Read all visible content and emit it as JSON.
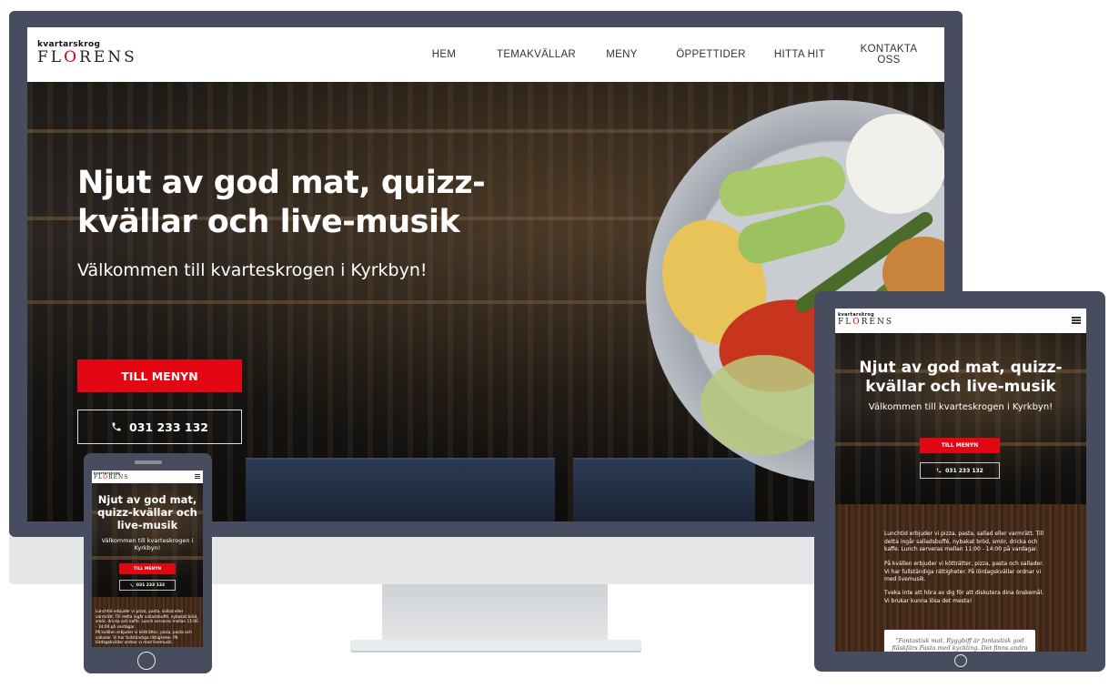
{
  "brand": {
    "logo_top": "kvartarskrog",
    "logo_bottom_pre": "FL",
    "logo_bottom_red": "O",
    "logo_bottom_post": "RENS",
    "accent_color": "#e30613"
  },
  "nav": {
    "items": [
      "HEM",
      "TEMAKVÄLLAR",
      "MENY",
      "ÖPPETTIDER",
      "HITTA HIT",
      "KONTAKTA OSS"
    ]
  },
  "hero": {
    "title": "Njut av god mat, quizz-kvällar och live-musik",
    "subtitle_desktop": "Välkommen till kvarteskrogen i Kyrkbyn!",
    "subtitle_mobile": "Välkommen till kvarteskrogen i Kyrkbyn!",
    "menu_button": "TILL MENYN",
    "phone_icon": "phone-icon",
    "phone_button": "031 233 132"
  },
  "content": {
    "tablet_paragraph_1": "Lunchtid erbjuder vi pizza, pasta, sallad eller varmrätt. Till detta ingår salladsbuffé, nybakat bröd, smör, dricka och kaffe. Lunch serveras mellan 11:00 - 14:00 på vardagar.",
    "tablet_paragraph_2": "På kvällen erbjuder vi kötträtter, pizza, pasta och sallader. Vi har fullständiga rättigheter. På lördagskvällar ordnar vi med livemusik.",
    "tablet_paragraph_3": "Tveka inte att höra av dig för att diskutera dina önskemål. Vi brukar kunna lösa det mesta!",
    "phone_paragraph_1": "Lunchtid erbjuder vi pizza, pasta, sallad eller varmrätt. Till detta ingår salladsbuffé, nybakat bröd, smör, dricka och kaffe. Lunch serveras mellan 11:00 - 14:00 på vardagar.",
    "phone_paragraph_2": "På kvällen erbjuder vi kötträtter, pizza, pasta och sallader. Vi har fullständiga rättigheter. På lördagskvällar ordnar vi med livemusik.",
    "quote": "\"Fantastisk mat. Ryggbiff är fantastisk god fläskfärs Pasta med kyckling. Det finns andra"
  }
}
